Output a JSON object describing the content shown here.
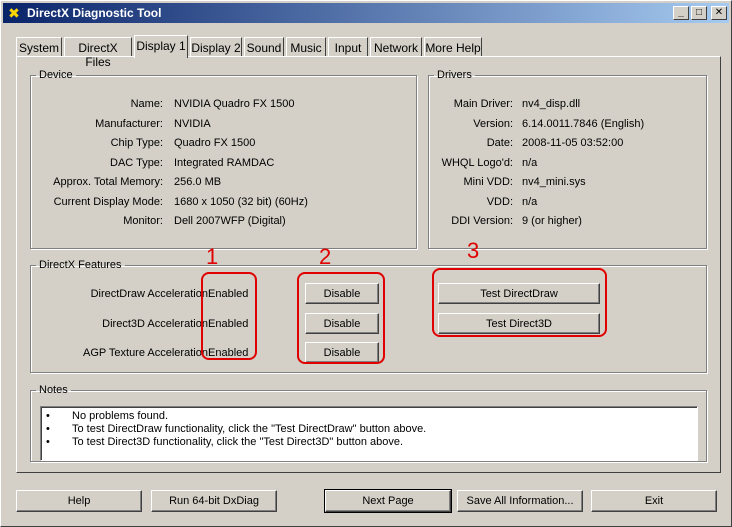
{
  "window": {
    "title": "DirectX Diagnostic Tool"
  },
  "titlebar_buttons": {
    "minimize": "_",
    "maximize": "□",
    "close": "✕"
  },
  "tabs": [
    {
      "label": "System"
    },
    {
      "label": "DirectX Files"
    },
    {
      "label": "Display 1"
    },
    {
      "label": "Display 2"
    },
    {
      "label": "Sound"
    },
    {
      "label": "Music"
    },
    {
      "label": "Input"
    },
    {
      "label": "Network"
    },
    {
      "label": "More Help"
    }
  ],
  "device": {
    "legend": "Device",
    "fields": [
      {
        "label": "Name:",
        "value": "NVIDIA Quadro FX 1500"
      },
      {
        "label": "Manufacturer:",
        "value": "NVIDIA"
      },
      {
        "label": "Chip Type:",
        "value": "Quadro FX 1500"
      },
      {
        "label": "DAC Type:",
        "value": "Integrated RAMDAC"
      },
      {
        "label": "Approx. Total Memory:",
        "value": "256.0 MB"
      },
      {
        "label": "Current Display Mode:",
        "value": "1680 x 1050 (32 bit) (60Hz)"
      },
      {
        "label": "Monitor:",
        "value": "Dell 2007WFP (Digital)"
      }
    ]
  },
  "drivers": {
    "legend": "Drivers",
    "fields": [
      {
        "label": "Main Driver:",
        "value": "nv4_disp.dll"
      },
      {
        "label": "Version:",
        "value": "6.14.0011.7846 (English)"
      },
      {
        "label": "Date:",
        "value": "2008-11-05 03:52:00"
      },
      {
        "label": "WHQL Logo'd:",
        "value": "n/a"
      },
      {
        "label": "Mini VDD:",
        "value": "nv4_mini.sys"
      },
      {
        "label": "VDD:",
        "value": "n/a"
      },
      {
        "label": "DDI Version:",
        "value": "9 (or higher)"
      }
    ]
  },
  "features": {
    "legend": "DirectX Features",
    "rows": [
      {
        "label": "DirectDraw Acceleration:",
        "status": "Enabled",
        "button": "Disable"
      },
      {
        "label": "Direct3D Acceleration:",
        "status": "Enabled",
        "button": "Disable"
      },
      {
        "label": "AGP Texture Acceleration:",
        "status": "Enabled",
        "button": "Disable"
      }
    ],
    "test_directdraw": "Test DirectDraw",
    "test_direct3d": "Test Direct3D"
  },
  "annotations": {
    "one": "1",
    "two": "2",
    "three": "3",
    "color": "#e00000"
  },
  "notes": {
    "legend": "Notes",
    "bullet": "•",
    "lines": [
      "No problems found.",
      "To test DirectDraw functionality, click the \"Test DirectDraw\" button above.",
      "To test Direct3D functionality, click the \"Test Direct3D\" button above."
    ]
  },
  "bottom_buttons": {
    "help": "Help",
    "run64": "Run 64-bit DxDiag",
    "next": "Next Page",
    "save": "Save All Information...",
    "exit": "Exit"
  }
}
